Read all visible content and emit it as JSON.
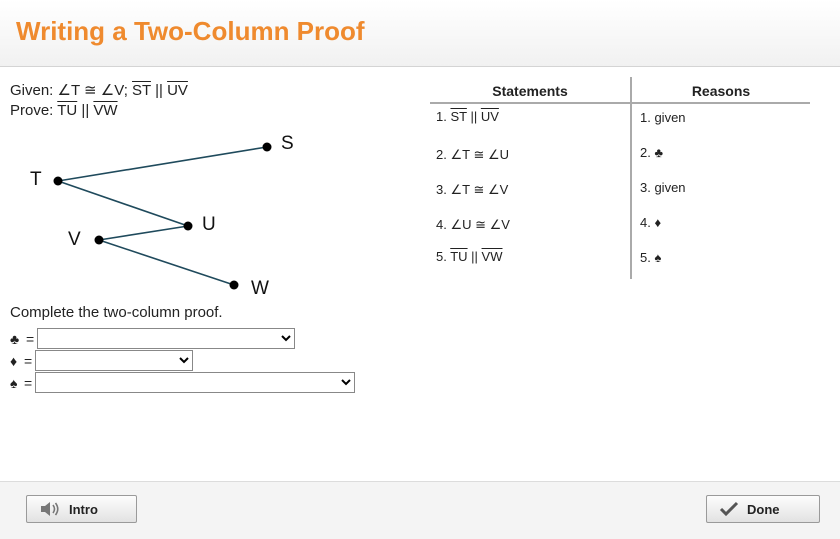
{
  "header": {
    "title": "Writing a Two-Column Proof"
  },
  "given": {
    "prefix": "Given: ",
    "angle1": "∠T",
    "cong": " ≅ ",
    "angle2": "∠V",
    "sep": "; ",
    "seg1": "ST",
    "par": " || ",
    "seg2": "UV"
  },
  "prove": {
    "prefix": "Prove: ",
    "seg1": "TU",
    "par": " || ",
    "seg2": "VW"
  },
  "diagram": {
    "labels": {
      "S": "S",
      "T": "T",
      "U": "U",
      "V": "V",
      "W": "W"
    }
  },
  "instruction": "Complete the two-column proof.",
  "answers": [
    {
      "symbol": "♣",
      "eq": "=",
      "value": ""
    },
    {
      "symbol": "♦",
      "eq": "=",
      "value": ""
    },
    {
      "symbol": "♠",
      "eq": "=",
      "value": ""
    }
  ],
  "table": {
    "headers": {
      "statements": "Statements",
      "reasons": "Reasons"
    },
    "rows": [
      {
        "num": "1. ",
        "stmt_a": "ST",
        "stmt_op": " || ",
        "stmt_b": "UV",
        "reason": "1. given"
      },
      {
        "num": "2. ",
        "stmt_a": "∠T",
        "stmt_op": " ≅ ",
        "stmt_b": "∠U",
        "reason": "2. ♣"
      },
      {
        "num": "3. ",
        "stmt_a": "∠T",
        "stmt_op": " ≅ ",
        "stmt_b": "∠V",
        "reason": "3. given"
      },
      {
        "num": "4. ",
        "stmt_a": "∠U",
        "stmt_op": " ≅ ",
        "stmt_b": "∠V",
        "reason": "4. ♦"
      },
      {
        "num": "5. ",
        "stmt_a": "TU",
        "stmt_op": " || ",
        "stmt_b": "VW",
        "reason": "5. ♠"
      }
    ]
  },
  "footer": {
    "intro_label": "Intro",
    "done_label": "Done"
  }
}
